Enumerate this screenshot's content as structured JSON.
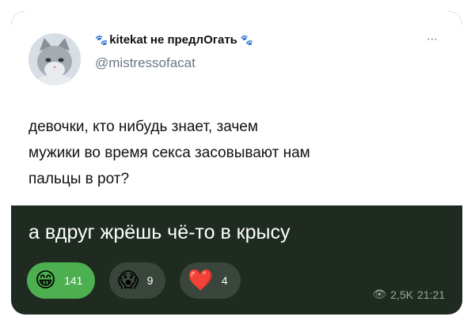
{
  "tweet": {
    "display_name": "kitekat не предлОгать",
    "handle": "@mistressofacat",
    "more_icon": "⋯",
    "text": "девочки, кто нибудь знает, зачем\nмужики во время секса засовывают нам\nпальцы в рот?"
  },
  "reply": {
    "caption": "а вдруг жрёшь чё-то в крысу"
  },
  "reactions": [
    {
      "icon": "grinning-face-icon",
      "emoji": "😁",
      "count": "141",
      "active": true
    },
    {
      "icon": "screaming-face-icon",
      "emoji": "😱",
      "count": "9",
      "active": false
    },
    {
      "icon": "red-heart-icon",
      "emoji": "❤️",
      "count": "4",
      "active": false
    }
  ],
  "meta": {
    "views": "2,5K",
    "time": "21:21"
  },
  "colors": {
    "panel": "#1f2a20",
    "active_reaction": "#4caf50"
  }
}
